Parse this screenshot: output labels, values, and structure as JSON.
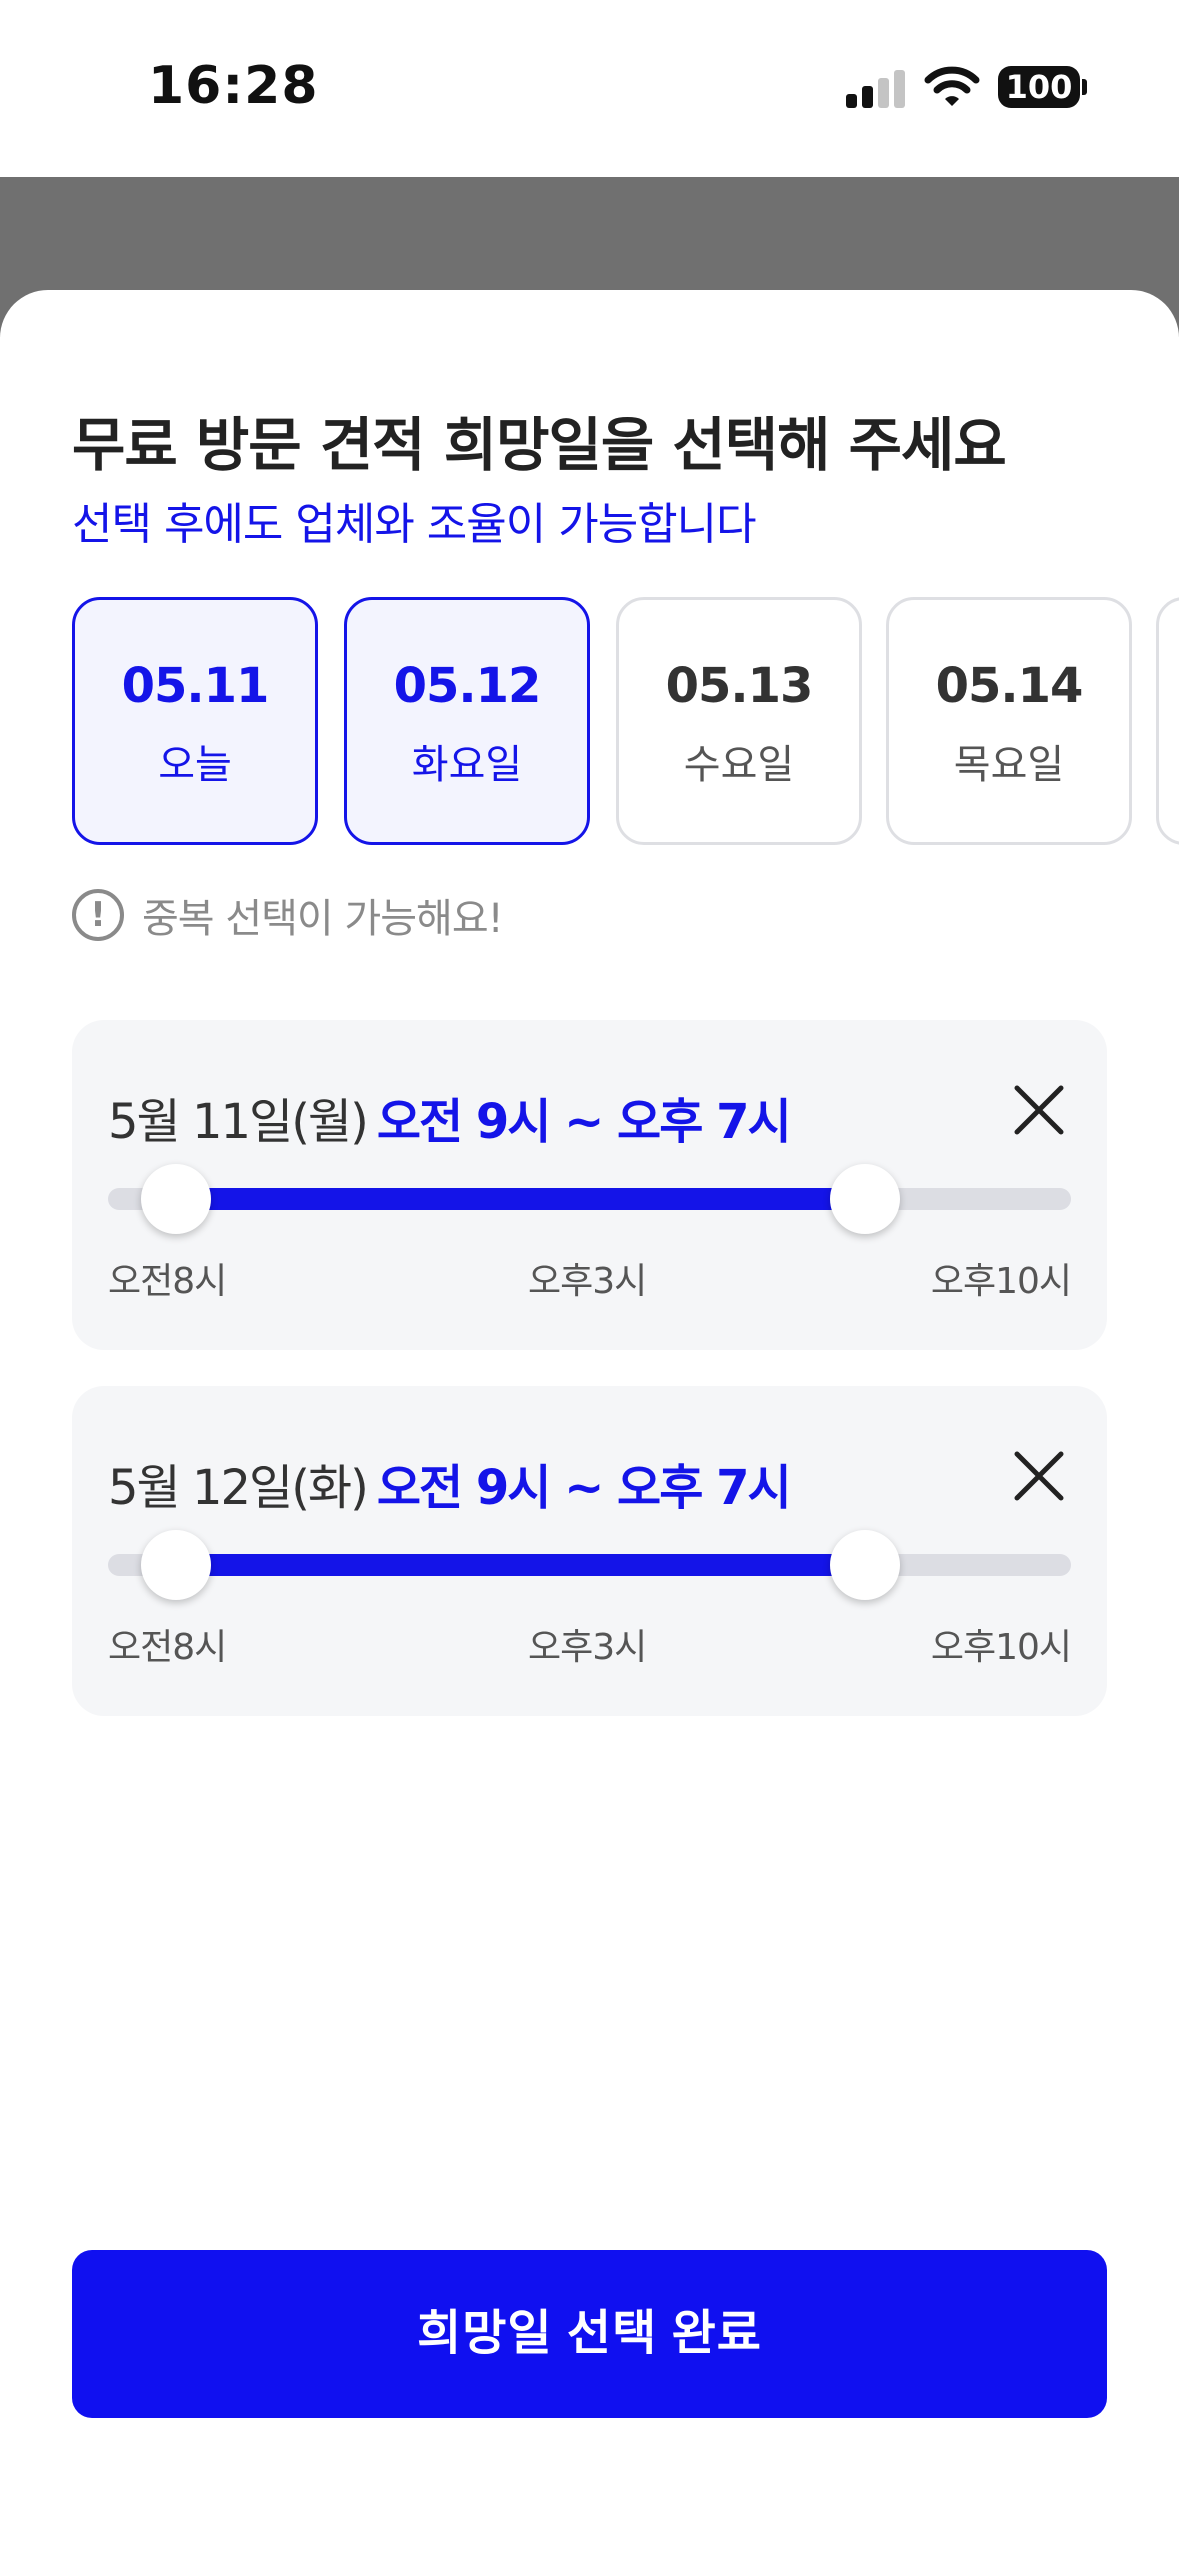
{
  "status_bar": {
    "time": "16:28",
    "battery": "100"
  },
  "sheet": {
    "title": "무료 방문 견적 희망일을 선택해 주세요",
    "subtitle": "선택 후에도 업체와 조율이 가능합니다"
  },
  "dates": [
    {
      "date": "05.11",
      "day": "오늘",
      "selected": true
    },
    {
      "date": "05.12",
      "day": "화요일",
      "selected": true
    },
    {
      "date": "05.13",
      "day": "수요일",
      "selected": false
    },
    {
      "date": "05.14",
      "day": "목요일",
      "selected": false
    }
  ],
  "notice": {
    "icon": "exclamation-circle-icon",
    "text": "중복 선택이 가능해요!"
  },
  "time_slots": [
    {
      "date_label": "5월 11일(월)",
      "range_label": "오전 9시 ~ 오후 7시",
      "range_min": "오전8시",
      "range_mid": "오후3시",
      "range_max": "오후10시",
      "start_fraction": 0.071,
      "end_fraction": 0.786
    },
    {
      "date_label": "5월 12일(화)",
      "range_label": "오전 9시 ~ 오후 7시",
      "range_min": "오전8시",
      "range_mid": "오후3시",
      "range_max": "오후10시",
      "start_fraction": 0.071,
      "end_fraction": 0.786
    }
  ],
  "confirm_button": {
    "label": "희망일 선택 완료"
  },
  "colors": {
    "accent": "#1414e8",
    "button": "#1010f0",
    "card_bg": "#f5f6f8"
  }
}
